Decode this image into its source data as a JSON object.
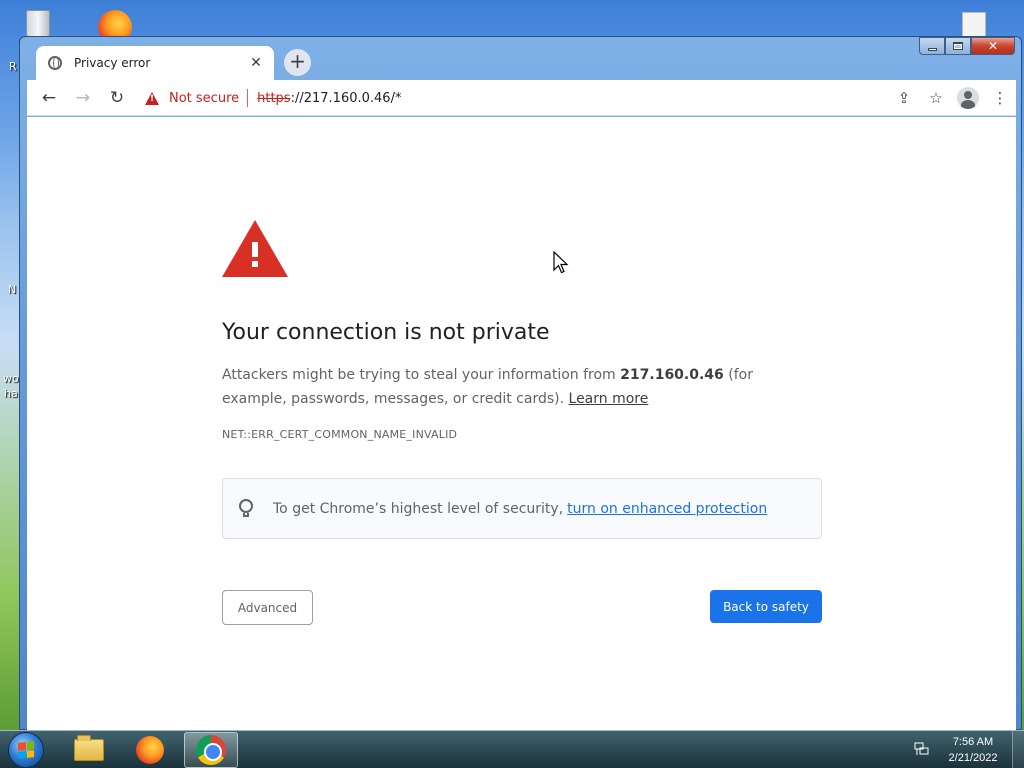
{
  "desktop": {
    "left_labels": [
      "R",
      "N",
      "wo",
      "ha"
    ]
  },
  "browser": {
    "tab": {
      "title": "Privacy error",
      "close": "✕"
    },
    "new_tab_symbol": "+",
    "toolbar": {
      "back": "←",
      "forward": "→",
      "reload": "↻",
      "security_label": "Not secure",
      "url_scheme": "https",
      "url_rest": "://217.160.0.46/*",
      "share": "⇪",
      "bookmark": "☆",
      "menu": "⋮"
    }
  },
  "page": {
    "heading": "Your connection is not private",
    "para_before": "Attackers might be trying to steal your information from ",
    "para_host": "217.160.0.46",
    "para_after": " (for example, passwords, messages, or credit cards). ",
    "learn_more": "Learn more",
    "error_code": "NET::ERR_CERT_COMMON_NAME_INVALID",
    "enhanced_text": "To get Chrome’s highest level of security,",
    "enhanced_link": "turn on enhanced protection",
    "advanced_button": "Advanced",
    "safety_button": "Back to safety"
  },
  "taskbar": {
    "time": "7:56 AM",
    "date": "2/21/2022"
  },
  "colors": {
    "danger": "#d93025",
    "primary_button": "#1a73e8",
    "link": "#1a73e8"
  },
  "icons": [
    "recycle-bin-icon",
    "firefox-icon",
    "file-icon",
    "globe-icon",
    "warning-triangle-icon",
    "lightbulb-icon",
    "windows-start-icon",
    "folder-icon",
    "chrome-icon",
    "network-icon",
    "mouse-cursor-icon"
  ]
}
